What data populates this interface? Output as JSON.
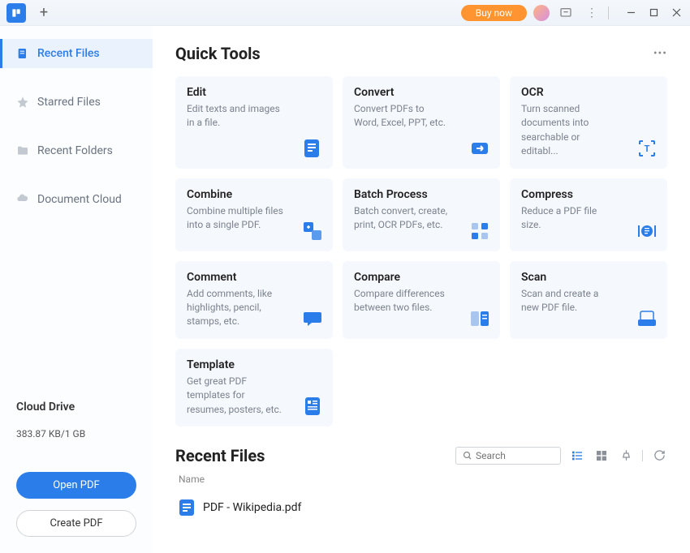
{
  "titlebar": {
    "buy_now": "Buy now"
  },
  "sidebar": {
    "items": [
      {
        "label": "Recent Files"
      },
      {
        "label": "Starred Files"
      },
      {
        "label": "Recent Folders"
      },
      {
        "label": "Document Cloud"
      }
    ],
    "cloud_title": "Cloud Drive",
    "cloud_usage": "383.87 KB/1 GB",
    "open_pdf": "Open PDF",
    "create_pdf": "Create PDF"
  },
  "quick_tools": {
    "title": "Quick Tools",
    "cards": [
      {
        "title": "Edit",
        "desc": "Edit texts and images in a file."
      },
      {
        "title": "Convert",
        "desc": "Convert PDFs to Word, Excel, PPT, etc."
      },
      {
        "title": "OCR",
        "desc": "Turn scanned documents into searchable or editabl..."
      },
      {
        "title": "Combine",
        "desc": "Combine multiple files into a single PDF."
      },
      {
        "title": "Batch Process",
        "desc": "Batch convert, create, print, OCR PDFs, etc."
      },
      {
        "title": "Compress",
        "desc": "Reduce a PDF file size."
      },
      {
        "title": "Comment",
        "desc": "Add comments, like highlights, pencil, stamps, etc."
      },
      {
        "title": "Compare",
        "desc": "Compare differences between two files."
      },
      {
        "title": "Scan",
        "desc": "Scan and create a new PDF file."
      },
      {
        "title": "Template",
        "desc": "Get great PDF templates for resumes, posters, etc."
      }
    ]
  },
  "recent_files": {
    "title": "Recent Files",
    "search_placeholder": "Search",
    "col_name": "Name",
    "files": [
      {
        "name": "PDF - Wikipedia.pdf"
      }
    ]
  },
  "colors": {
    "accent": "#2b7de9",
    "card_bg": "#f5f8fc",
    "orange": "#ff9430"
  }
}
